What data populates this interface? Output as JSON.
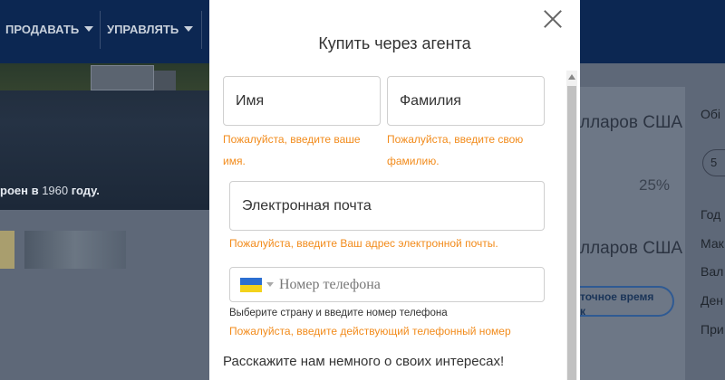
{
  "background": {
    "nav": {
      "sell": "ПРОДАВАТЬ",
      "manage": "УПРАВЛЯТЬ"
    },
    "hero": {
      "built_prefix": "роен в",
      "built_year": "1960",
      "built_suffix": "году."
    },
    "right": {
      "currency1": "лларов США",
      "percent": "25%",
      "currency2": "лларов США",
      "pill_line1": "точное время",
      "pill_line2": "к"
    },
    "far_right": {
      "item1": "Обі",
      "pill": "5",
      "item2": "Год",
      "item3": "Мак",
      "item4": "Вал",
      "item5": "Ден",
      "item6": "При"
    }
  },
  "modal": {
    "title": "Купить через агента",
    "first_name": {
      "placeholder": "Имя",
      "error_line1": "Пожалуйста, введите ваше",
      "error_line2": "имя."
    },
    "last_name": {
      "placeholder": "Фамилия",
      "error_line1": "Пожалуйста, введите свою",
      "error_line2": "фамилию."
    },
    "email": {
      "placeholder": "Электронная почта",
      "error": "Пожалуйста, введите Ваш адрес электронной почты."
    },
    "phone": {
      "placeholder": "Номер телефона",
      "hint": "Выберите страну и введите номер телефона",
      "error": "Пожалуйста, введите действующий телефонный номер"
    },
    "interests_heading": "Расскажите нам немного о своих интересах!"
  },
  "colors": {
    "nav_bg": "#0c2752",
    "error": "#f28b1b",
    "modal_bg": "#ffffff",
    "flag_blue": "#2c6fd1",
    "flag_yellow": "#f3d21c"
  },
  "icons": {
    "close": "close-icon",
    "flag": "ukraine-flag-icon",
    "dropdown": "chevron-down-icon"
  }
}
